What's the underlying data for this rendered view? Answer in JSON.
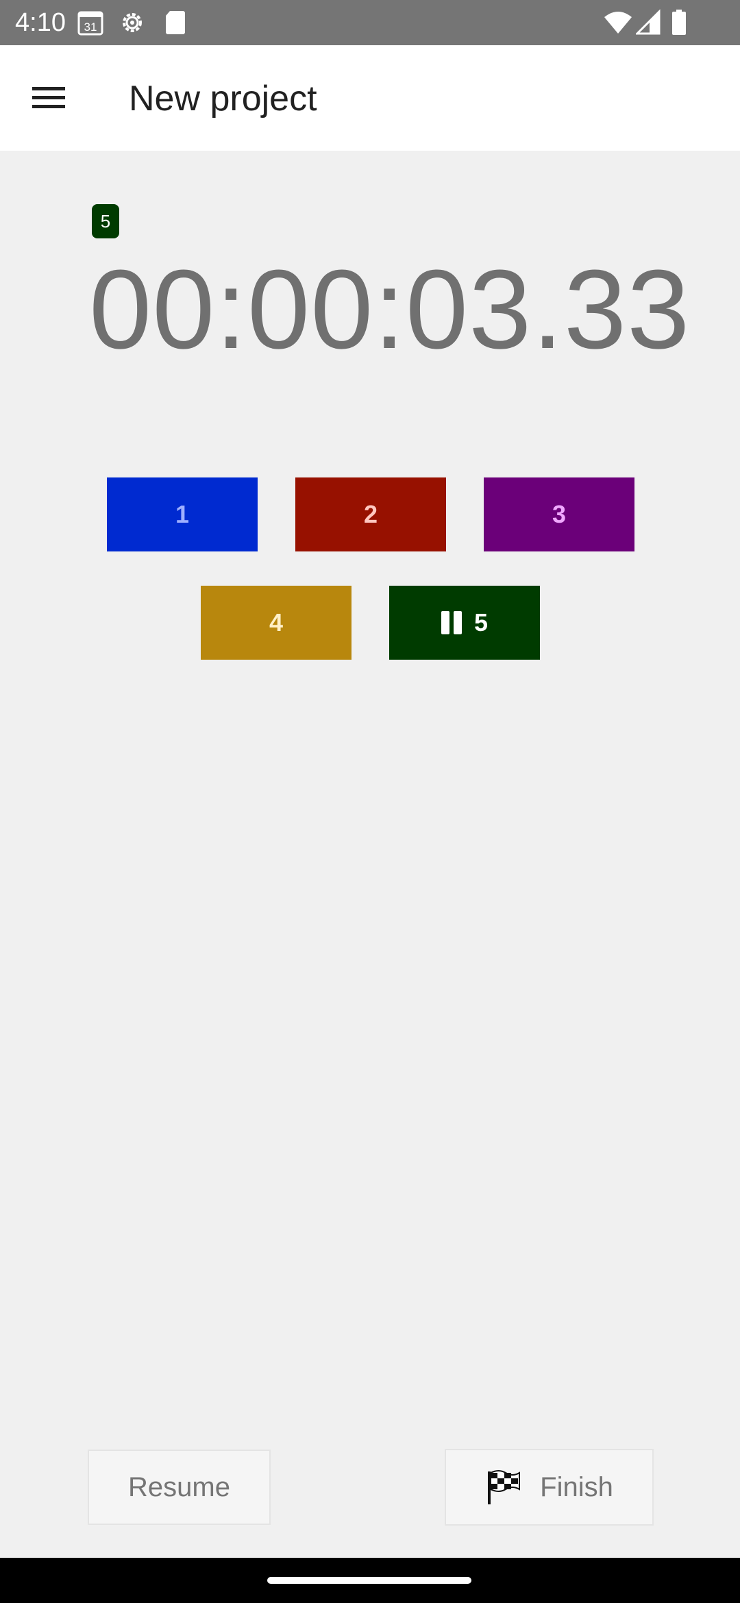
{
  "status_bar": {
    "time": "4:10",
    "calendar_day": "31",
    "left_icons": [
      "calendar-icon",
      "settings-icon",
      "sd-card-icon"
    ],
    "right_icons": [
      "wifi-icon",
      "signal-icon",
      "battery-icon"
    ]
  },
  "app_bar": {
    "title": "New project",
    "menu_icon": "hamburger-menu-icon"
  },
  "active_counter_badge": "5",
  "timer": "00:00:03.33",
  "counters": [
    {
      "label": "1",
      "bg": "#002ad0",
      "fg": "#9fb0ff",
      "paused": false
    },
    {
      "label": "2",
      "bg": "#971100",
      "fg": "#ffc8c0",
      "paused": false
    },
    {
      "label": "3",
      "bg": "#6b0079",
      "fg": "#f0a8ff",
      "paused": false
    },
    {
      "label": "4",
      "bg": "#b8870d",
      "fg": "#fff0c8",
      "paused": false
    },
    {
      "label": "5",
      "bg": "#003b00",
      "fg": "#ffffff",
      "paused": true,
      "icon": "pause-icon"
    }
  ],
  "actions": {
    "resume_label": "Resume",
    "finish_label": "Finish",
    "finish_icon": "checkered-flag-icon"
  }
}
